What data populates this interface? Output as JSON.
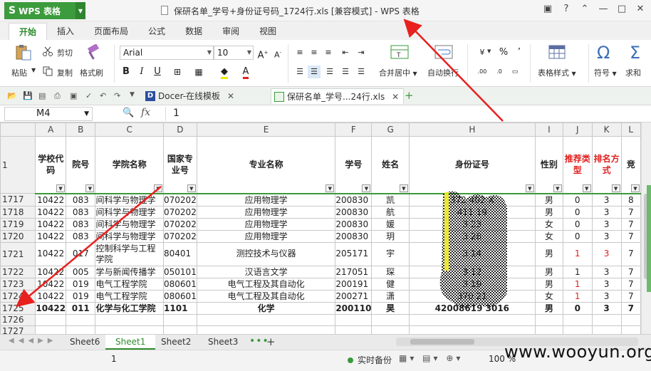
{
  "app": {
    "name": "WPS 表格",
    "logo": "S"
  },
  "window": {
    "title": "保研名单_学号+身份证号码_1724行.xls [兼容模式] - WPS 表格"
  },
  "ribbon_tabs": [
    "开始",
    "插入",
    "页面布局",
    "公式",
    "数据",
    "审阅",
    "视图"
  ],
  "ribbon": {
    "paste": "粘贴",
    "cut": "剪切",
    "copy": "复制",
    "format_painter": "格式刷",
    "font_name": "Arial",
    "font_size": "10",
    "merge_center": "合并居中",
    "auto_wrap": "自动换行",
    "table_style": "表格样式",
    "symbol": "符号",
    "sum": "求和",
    "percent": "%",
    "comma": "’"
  },
  "docbar": {
    "tabs": [
      {
        "label": "Docer-在线模板",
        "active": false
      },
      {
        "label": "保研名单_学号...24行.xls",
        "active": true
      }
    ]
  },
  "formula_bar": {
    "cell": "M4",
    "fx": "fx",
    "value": "1"
  },
  "columns": [
    "A",
    "B",
    "C",
    "D",
    "E",
    "F",
    "G",
    "H",
    "I",
    "J",
    "K",
    "L"
  ],
  "header_row": {
    "row": "1",
    "cells": [
      "学校代码",
      "院号",
      "学院名称",
      "国家专业号",
      "专业名称",
      "学号",
      "姓名",
      "身份证号",
      "性别",
      "推荐类型",
      "排名方式",
      "竞"
    ]
  },
  "rows": [
    {
      "row": "1717",
      "cells": [
        "10422",
        "083",
        "间科学与物理学",
        "070202",
        "应用物理学",
        "200830",
        "凯",
        "372    402    X",
        "男",
        "0",
        "3",
        "8"
      ]
    },
    {
      "row": "1718",
      "cells": [
        "10422",
        "083",
        "间科学与物理学",
        "070202",
        "应用物理学",
        "200830",
        "航",
        "411          19",
        "男",
        "0",
        "3",
        "7"
      ]
    },
    {
      "row": "1719",
      "cells": [
        "10422",
        "083",
        "间科学与物理学",
        "070202",
        "应用物理学",
        "200830",
        "媛",
        "3            23",
        "女",
        "0",
        "3",
        "7"
      ]
    },
    {
      "row": "1720",
      "cells": [
        "10422",
        "083",
        "间科学与物理学",
        "070202",
        "应用物理学",
        "200830",
        "玥",
        "3            28",
        "女",
        "0",
        "3",
        "7"
      ]
    },
    {
      "row": "1721",
      "cells": [
        "10422",
        "017",
        "控制科学与工程学院",
        "80401",
        "测控技术与仪器",
        "205171",
        "宇",
        "3            14",
        "男",
        "1",
        "3",
        "7"
      ]
    },
    {
      "row": "1722",
      "cells": [
        "10422",
        "005",
        "学与新闻传播学",
        "050101",
        "汉语言文学",
        "217051",
        "琛",
        "3            12",
        "男",
        "1",
        "3",
        "7"
      ]
    },
    {
      "row": "1723",
      "cells": [
        "10422",
        "019",
        "电气工程学院",
        "080601",
        "电气工程及其自动化",
        "200191",
        "健",
        "3            19",
        "男",
        "1",
        "3",
        "7"
      ]
    },
    {
      "row": "1724",
      "cells": [
        "10422",
        "019",
        "电气工程学院",
        "080601",
        "电气工程及其自动化",
        "200271",
        "潇",
        "370          21",
        "女",
        "1",
        "3",
        "7"
      ]
    },
    {
      "row": "1725",
      "cells": [
        "10422",
        "011",
        "化学与化工学院",
        "1101",
        "化学",
        "200110",
        "昊",
        "42008619   3016",
        "男",
        "0",
        "3",
        "7"
      ]
    }
  ],
  "empty_rows": [
    "1726",
    "1727"
  ],
  "sheets": [
    "Sheet6",
    "Sheet1",
    "Sheet2",
    "Sheet3"
  ],
  "active_sheet": "Sheet1",
  "status": {
    "value": "1",
    "backup": "实时备份",
    "zoom": "100 %"
  },
  "watermark": "www.wooyun.org",
  "colors": {
    "accent": "#2e8b2e",
    "red_header": "#e02020",
    "annotation_arrow": "#e8201e"
  },
  "icons": [
    "paste-icon",
    "cut-icon",
    "copy-icon",
    "format-painter-icon",
    "merge-icon",
    "wrap-icon",
    "table-style-icon",
    "omega-icon",
    "sigma-icon",
    "fx-icon",
    "filter-icon"
  ]
}
